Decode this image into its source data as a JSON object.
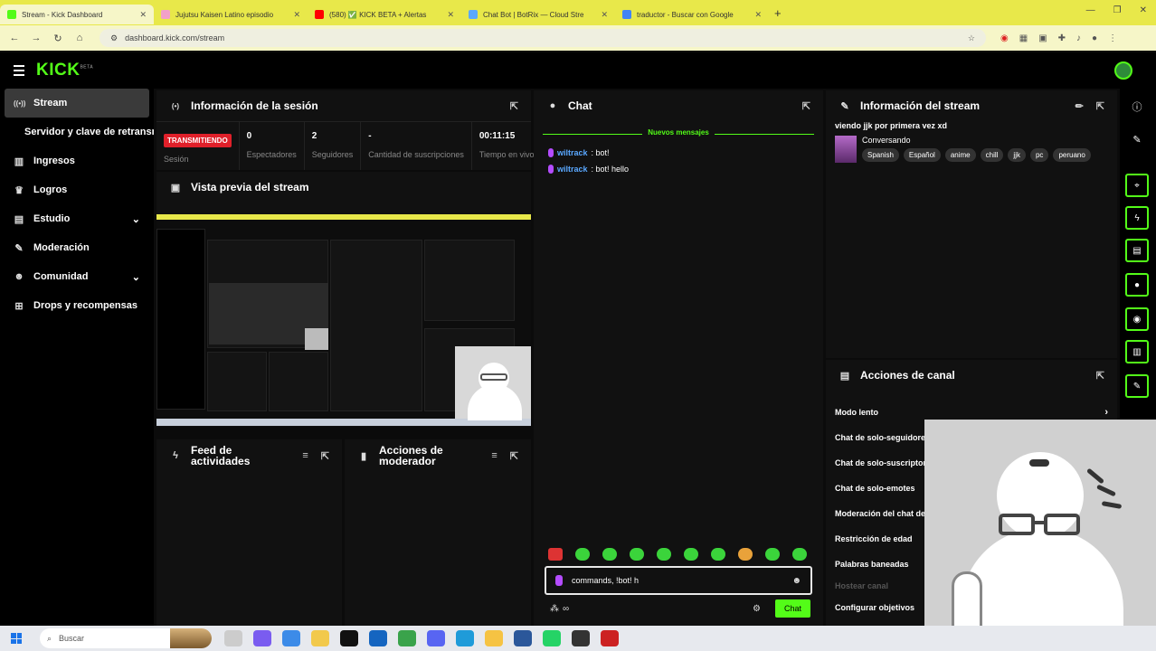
{
  "browser": {
    "tabs": [
      {
        "title": "Stream - Kick Dashboard",
        "color": "#53fc18",
        "active": true
      },
      {
        "title": "Jujutsu Kaisen Latino episodio",
        "color": "#f2a0c8",
        "active": false
      },
      {
        "title": "(580) ✅ KICK BETA + Alertas",
        "color": "#ff0000",
        "active": false
      },
      {
        "title": "Chat Bot | BotRix — Cloud Stre",
        "color": "#5aa8ff",
        "active": false
      },
      {
        "title": "traductor - Buscar con Google",
        "color": "#4285f4",
        "active": false
      }
    ],
    "url": "dashboard.kick.com/stream"
  },
  "brand": {
    "logo": "KICK",
    "beta": "BETA",
    "accent": "#53fc18"
  },
  "sidebar": {
    "items": [
      {
        "label": "Stream",
        "icon": "broadcast-icon",
        "glyph": "((•))",
        "active": true
      },
      {
        "label": "Servidor y clave de retransmisión",
        "sub": true
      },
      {
        "label": "Ingresos",
        "icon": "chart-icon",
        "glyph": "▥"
      },
      {
        "label": "Logros",
        "icon": "trophy-icon",
        "glyph": "🏆"
      },
      {
        "label": "Estudio",
        "icon": "studio-icon",
        "glyph": "▤",
        "chev": "⌄"
      },
      {
        "label": "Moderación",
        "icon": "wrench-icon",
        "glyph": "🔧"
      },
      {
        "label": "Comunidad",
        "icon": "people-icon",
        "glyph": "👥",
        "chev": "⌄"
      },
      {
        "label": "Drops y recompensas",
        "icon": "gift-icon",
        "glyph": "🎁"
      }
    ]
  },
  "session": {
    "title": "Información de la sesión",
    "status": "TRANSMITIENDO",
    "session_label": "Sesión",
    "stats": [
      {
        "value": "0",
        "label": "Espectadores"
      },
      {
        "value": "2",
        "label": "Seguidores"
      },
      {
        "value": "-",
        "label": "Cantidad de suscripciones"
      },
      {
        "value": "00:11:15",
        "label": "Tiempo en vivo"
      }
    ]
  },
  "preview": {
    "title": "Vista previa del stream"
  },
  "feed": {
    "title": "Feed de actividades"
  },
  "modactions": {
    "title": "Acciones de moderador"
  },
  "chat": {
    "title": "Chat",
    "new_messages": "Nuevos mensajes",
    "messages": [
      {
        "user": "wiltrack",
        "text": ": bot!"
      },
      {
        "user": "wiltrack",
        "text": ": bot! hello"
      }
    ],
    "input_value": "commands, !bot! h",
    "send_label": "Chat",
    "infinity": "∞"
  },
  "streaminfo": {
    "title": "Información del stream",
    "stream_title": "viendo jjk por primera vez xd",
    "category": "Conversando",
    "tags": [
      "Spanish",
      "Español",
      "anime",
      "chill",
      "jjk",
      "pc",
      "peruano"
    ]
  },
  "channel": {
    "title": "Acciones de canal",
    "actions": [
      {
        "label": "Modo lento",
        "chev": "›"
      },
      {
        "label": "Chat de solo-seguidores"
      },
      {
        "label": "Chat de solo-suscriptores"
      },
      {
        "label": "Chat de solo-emotes"
      },
      {
        "label": "Moderación del chat de bots"
      },
      {
        "label": "Restricción de edad"
      },
      {
        "label": "Palabras baneadas"
      },
      {
        "label": "Hostear canal",
        "dim": true
      },
      {
        "label": "Configurar objetivos"
      }
    ]
  },
  "taskbar": {
    "search": "Buscar"
  }
}
